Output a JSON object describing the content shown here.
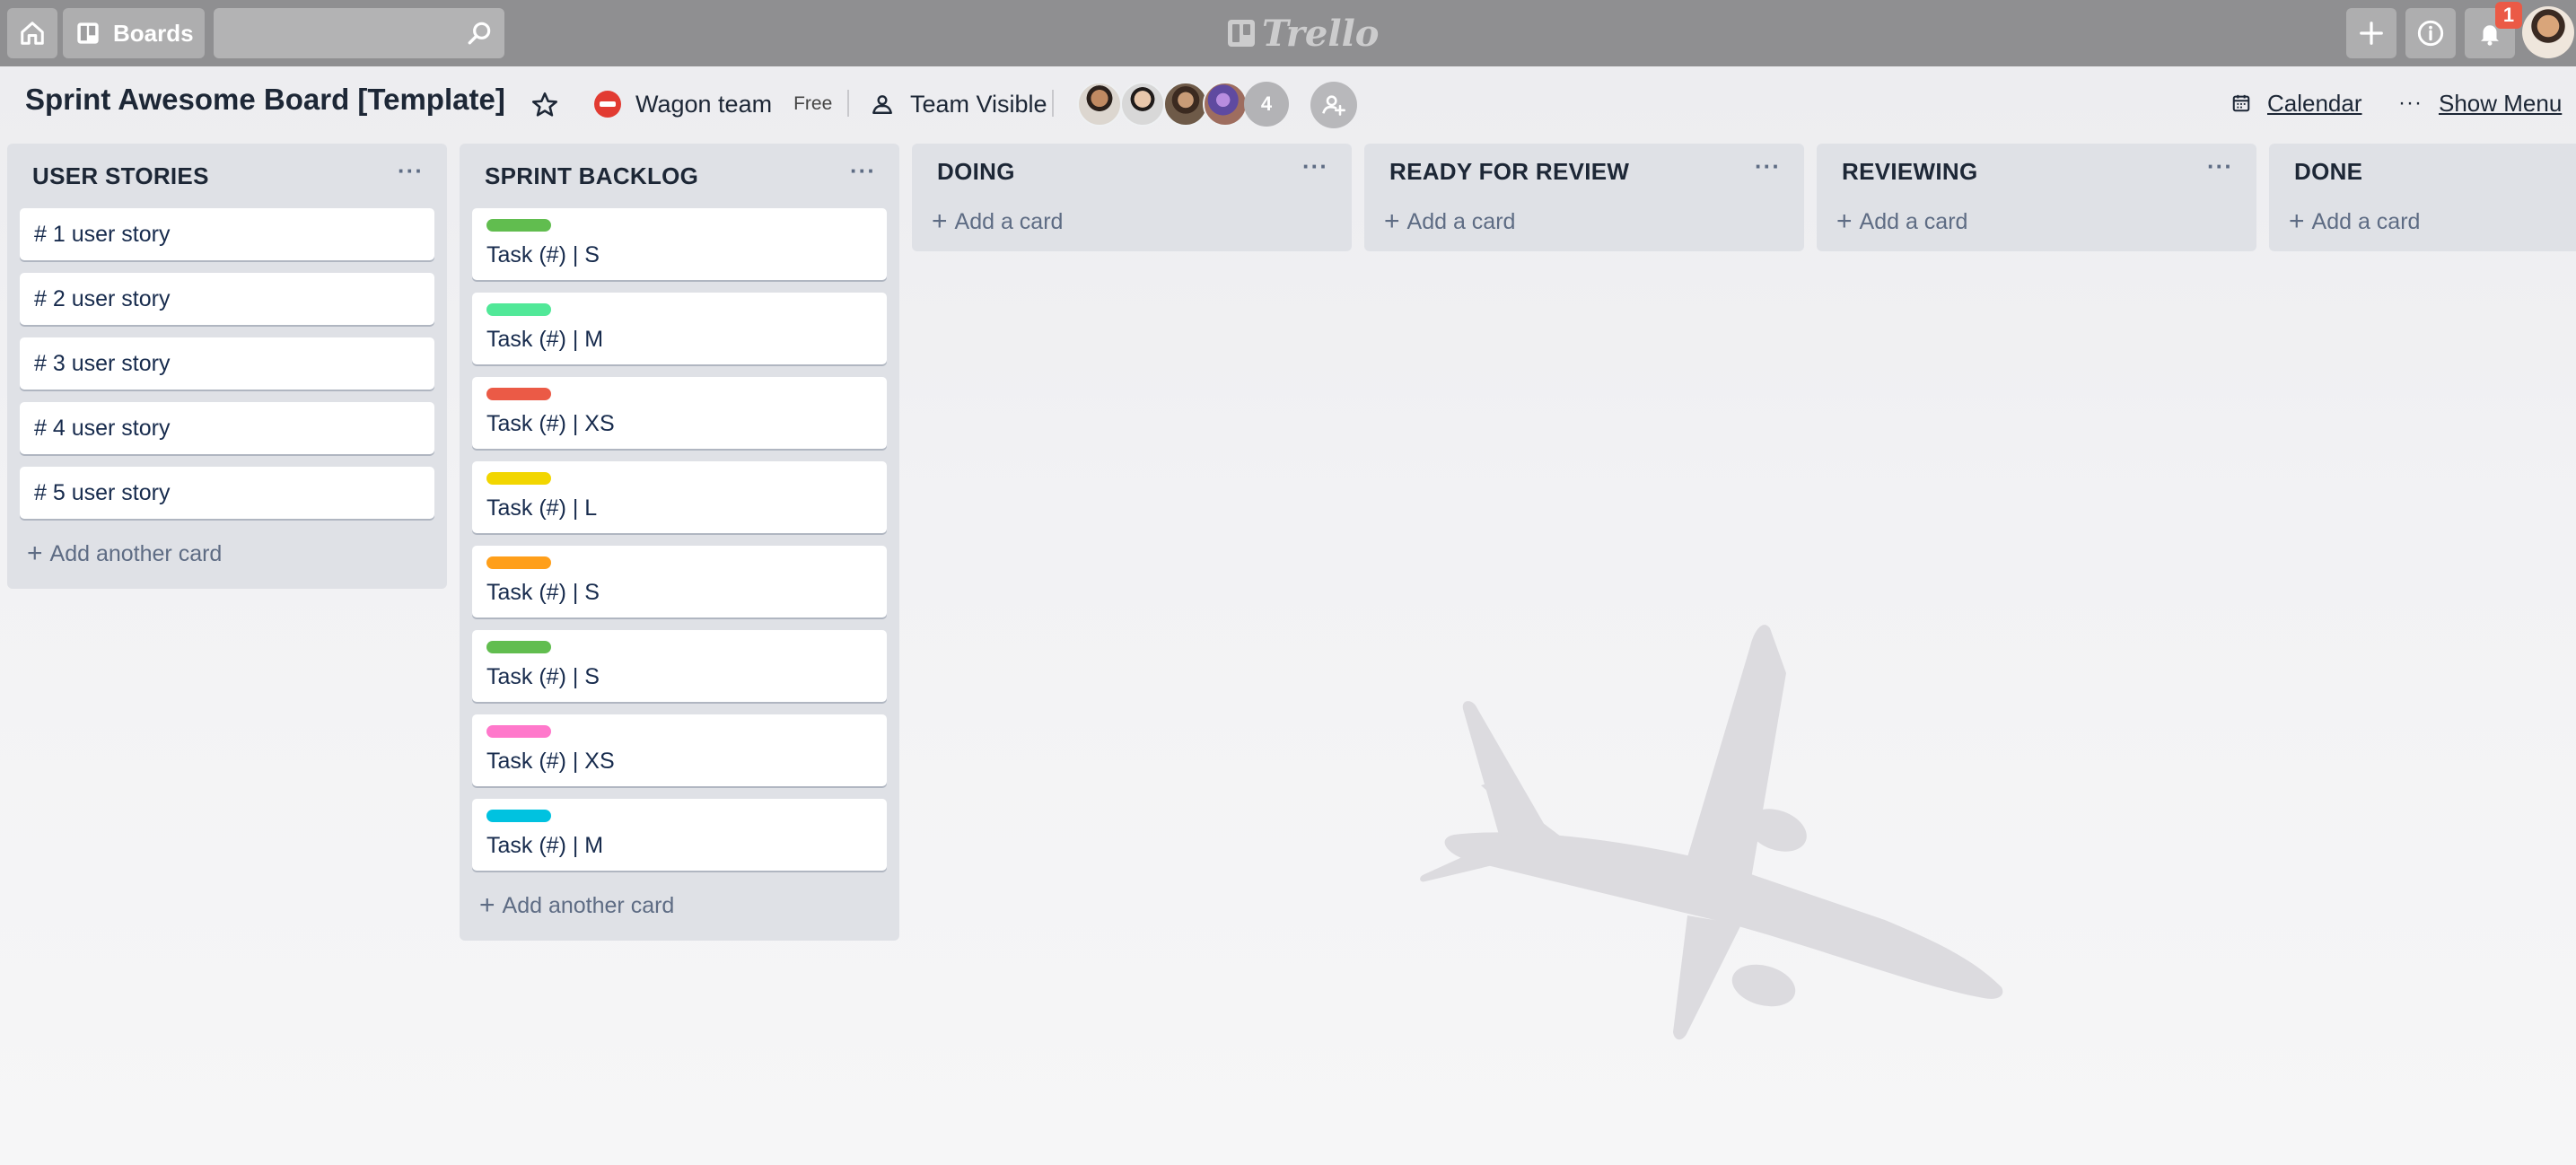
{
  "nav": {
    "boards_label": "Boards",
    "search": {
      "placeholder": "",
      "value": ""
    },
    "logo_text": "Trello",
    "notification_count": "1"
  },
  "board": {
    "title": "Sprint Awesome Board [Template]",
    "team_name": "Wagon team",
    "team_plan": "Free",
    "visibility": "Team Visible",
    "extra_members_count": "4",
    "calendar_label": "Calendar",
    "show_menu_label": "Show Menu"
  },
  "lists": [
    {
      "title": "USER STORIES",
      "cards": [
        "# 1 user story",
        "# 2 user story",
        "# 3 user story",
        "# 4 user story",
        "# 5 user story"
      ],
      "add_label": "Add another card"
    },
    {
      "title": "SPRINT BACKLOG",
      "cards": [
        {
          "text": "Task (#) | S",
          "label_color": "#61bd4f"
        },
        {
          "text": "Task (#) | M",
          "label_color": "#51e898"
        },
        {
          "text": "Task (#) | XS",
          "label_color": "#eb5a46"
        },
        {
          "text": "Task (#) | L",
          "label_color": "#f2d600"
        },
        {
          "text": "Task (#) | S",
          "label_color": "#ff9f1a"
        },
        {
          "text": "Task (#) | S",
          "label_color": "#61bd4f"
        },
        {
          "text": "Task (#) | XS",
          "label_color": "#ff78cb"
        },
        {
          "text": "Task (#) | M",
          "label_color": "#00c2e0"
        }
      ],
      "add_label": "Add another card"
    },
    {
      "title": "DOING",
      "cards": [],
      "add_label": "Add a card"
    },
    {
      "title": "READY FOR REVIEW",
      "cards": [],
      "add_label": "Add a card"
    },
    {
      "title": "REVIEWING",
      "cards": [],
      "add_label": "Add a card"
    },
    {
      "title": "DONE",
      "cards": [],
      "add_label": "Add a card"
    }
  ],
  "colors": {
    "topbar": "#8f8f91",
    "list_background": "#dfe1e6",
    "text": "#172b4d"
  }
}
